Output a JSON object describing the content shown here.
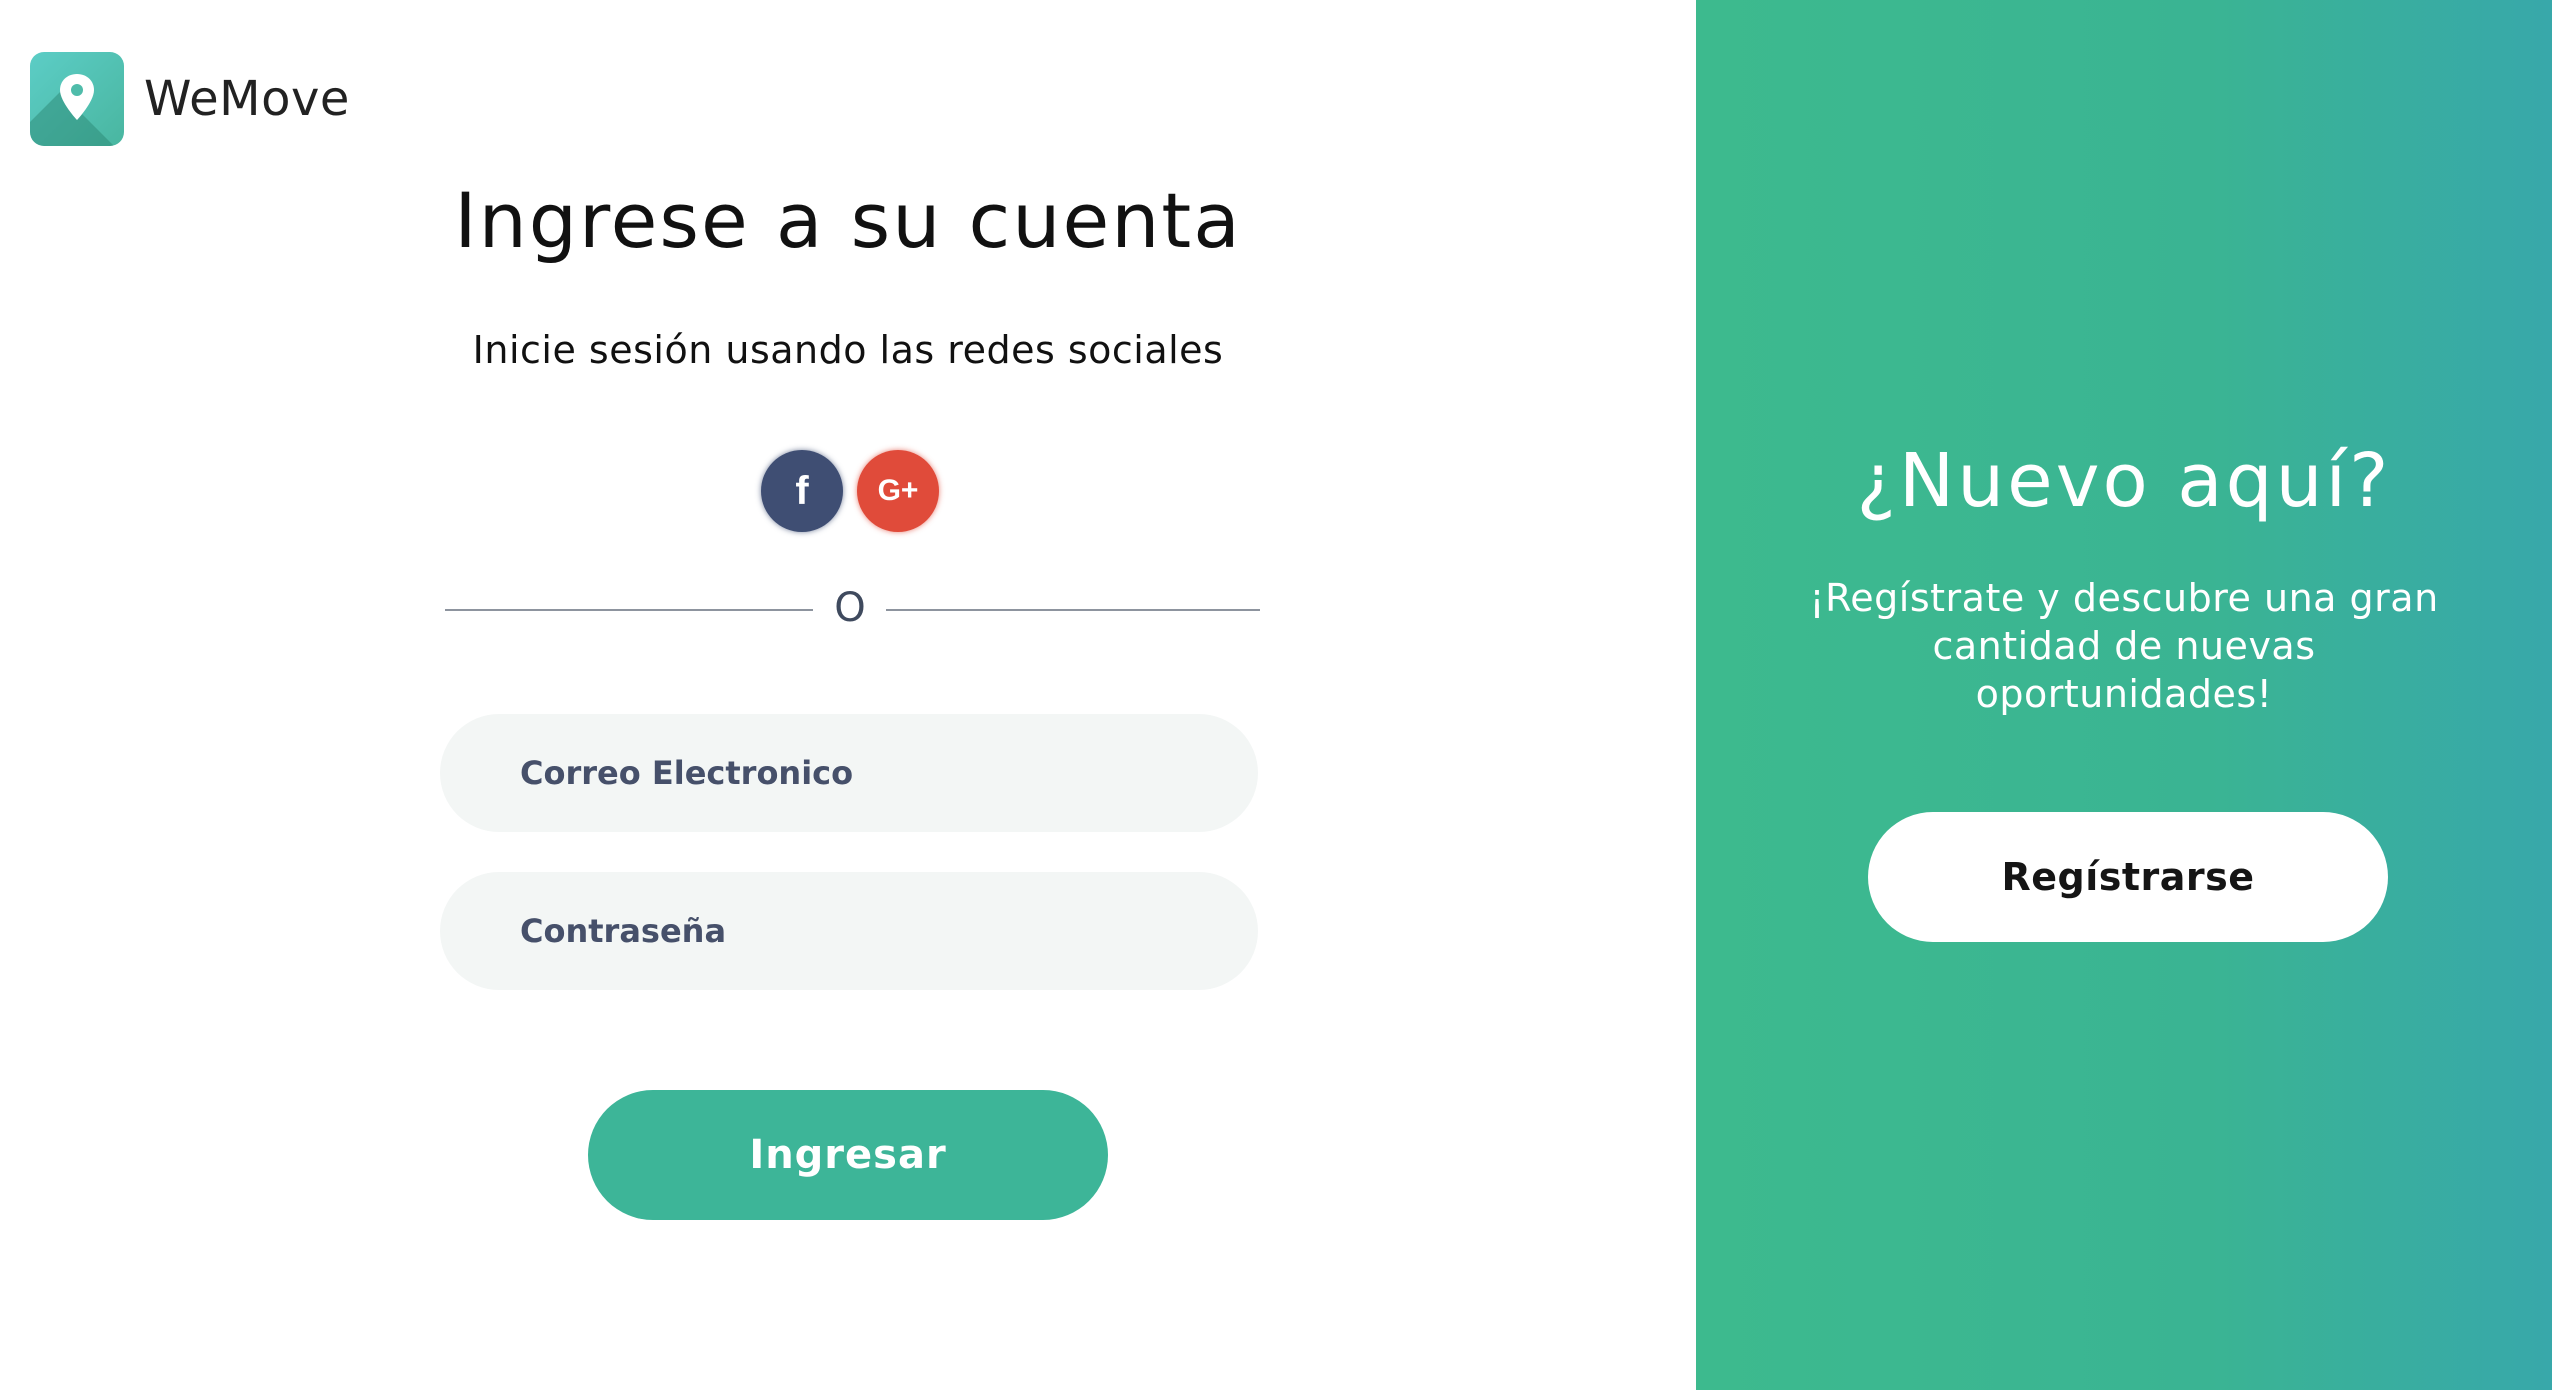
{
  "brand": {
    "name": "WeMove",
    "logo_icon": "map-pin-icon",
    "logo_colors": [
      "#5ccdc6",
      "#49b6a0"
    ]
  },
  "login": {
    "title": "Ingrese a su cuenta",
    "social_subtitle": "Inicie sesión usando las redes sociales",
    "social": [
      {
        "name": "facebook",
        "glyph": "f",
        "icon": "facebook-icon",
        "color": "#3f4e73"
      },
      {
        "name": "google-plus",
        "glyph": "G+",
        "icon": "google-plus-icon",
        "color": "#e04b3a"
      }
    ],
    "divider_text": "O",
    "email_placeholder": "Correo Electronico",
    "password_placeholder": "Contraseña",
    "submit_label": "Ingresar"
  },
  "signup": {
    "title": "¿Nuevo aquí?",
    "text": "¡Regístrate y descubre una gran cantidad de nuevas oportunidades!",
    "button_label": "Regístrarse"
  },
  "colors": {
    "accent": "#3db598",
    "panel_gradient": [
      "#3dba8e",
      "#38a8aa"
    ],
    "field_bg": "#f3f6f5",
    "field_text": "#46506a"
  }
}
